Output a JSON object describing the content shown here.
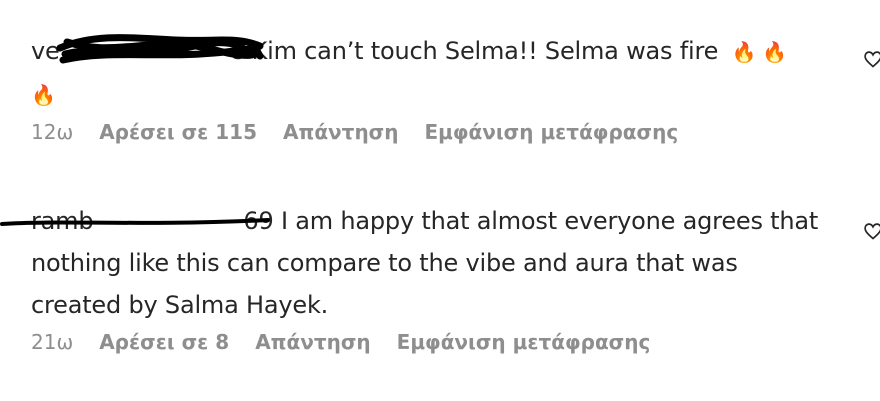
{
  "comments": [
    {
      "username": "ve",
      "text_tail": "e Kim can’t touch Selma!! Selma was fire",
      "emoji": "🔥",
      "emoji_count": 3,
      "time": "12ω",
      "likes": "Αρέσει σε 115",
      "reply": "Απάντηση",
      "translate": "Εμφάνιση μετάφρασης",
      "like_icon": "heart-icon"
    },
    {
      "username": "ramb",
      "text_tail": "69 I am happy that almost everyone agrees that nothing like this can compare to the vibe and aura that was created by Salma Hayek.",
      "time": "21ω",
      "likes": "Αρέσει σε 8",
      "reply": "Απάντηση",
      "translate": "Εμφάνιση μετάφρασης",
      "like_icon": "heart-icon"
    }
  ],
  "colors": {
    "text": "#262626",
    "meta": "#8e8e8e",
    "redaction": "#000000",
    "fire": "#f57c00"
  }
}
